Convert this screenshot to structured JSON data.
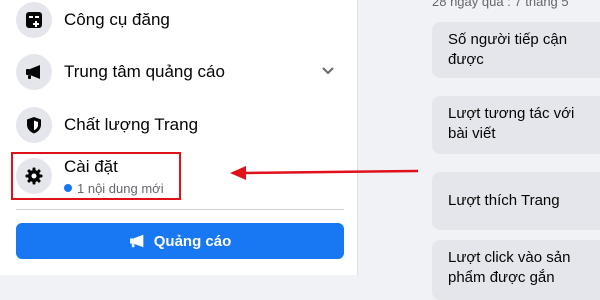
{
  "sidebar": {
    "items": [
      {
        "label": "Công cụ đăng",
        "icon": "post-tools-icon"
      },
      {
        "label": "Trung tâm quảng cáo",
        "icon": "megaphone-icon"
      },
      {
        "label": "Chất lượng Trang",
        "icon": "shield-icon"
      }
    ],
    "settings": {
      "label": "Cài đặt",
      "icon": "gear-icon",
      "notice": "1 nội dung mới"
    },
    "ad_button": {
      "label": "Quảng cáo",
      "icon": "megaphone-icon"
    }
  },
  "insights": {
    "period_text": "28 ngày qua : 7 tháng 5",
    "metrics": [
      {
        "label": "Số người tiếp cận được"
      },
      {
        "label": "Lượt tương tác với bài viết"
      },
      {
        "label": "Lượt thích Trang"
      },
      {
        "label": "Lượt click vào sản phẩm được gắn"
      }
    ]
  },
  "colors": {
    "accent": "#1877f2",
    "highlight": "#e0111a",
    "icon_bg": "#e4e6eb"
  }
}
